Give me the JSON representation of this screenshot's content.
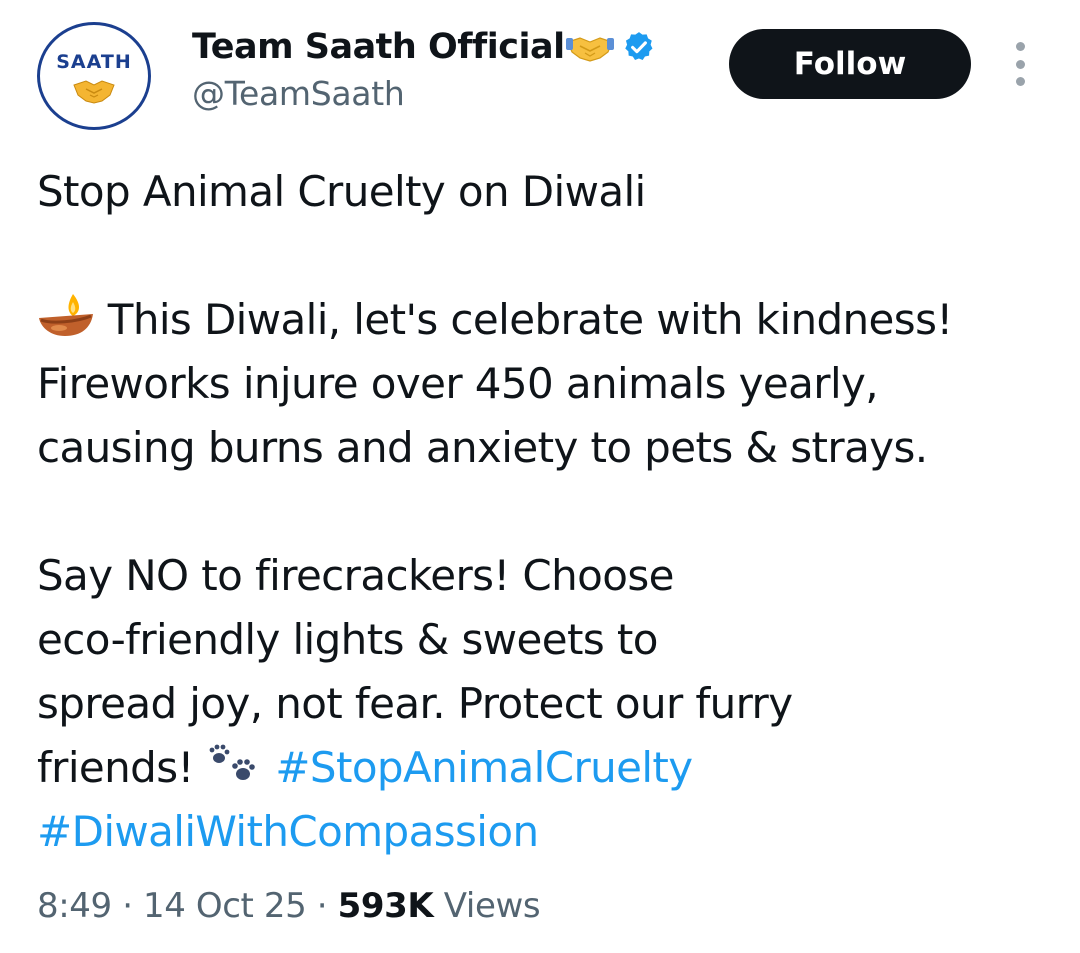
{
  "author": {
    "avatar_text": "SAATH",
    "display_name": "Team Saath Official",
    "name_emoji_icon": "handshake-icon",
    "verified_icon": "verified-badge-icon",
    "handle": "@TeamSaath"
  },
  "actions": {
    "follow_label": "Follow",
    "more_icon": "vertical-ellipsis-icon"
  },
  "tweet": {
    "line1": "Stop Animal Cruelty on Diwali",
    "line2_emoji_icon": "diya-lamp-icon",
    "line2": "This Diwali, let's celebrate with kindness!",
    "line3": "Fireworks injure over 450 animals yearly,",
    "line4": "causing burns and anxiety to pets & strays.",
    "line5": "Say NO to firecrackers! Choose",
    "line6": "eco-friendly lights & sweets to",
    "line7": "spread joy, not fear. Protect our furry",
    "line8": "friends!",
    "line8_emoji_icon": "paw-prints-icon",
    "hashtag1": "#StopAnimalCruelty",
    "hashtag2": "#DiwaliWithCompassion"
  },
  "meta": {
    "time": "8:49",
    "separator": "·",
    "date": "14 Oct 25",
    "views_count": "593K",
    "views_label": "Views"
  },
  "colors": {
    "text_primary": "#0f1419",
    "text_secondary": "#536471",
    "link": "#1d9bf0",
    "follow_bg": "#0f1419",
    "verified": "#1d9bf0",
    "avatar_border": "#1b3f8f"
  }
}
